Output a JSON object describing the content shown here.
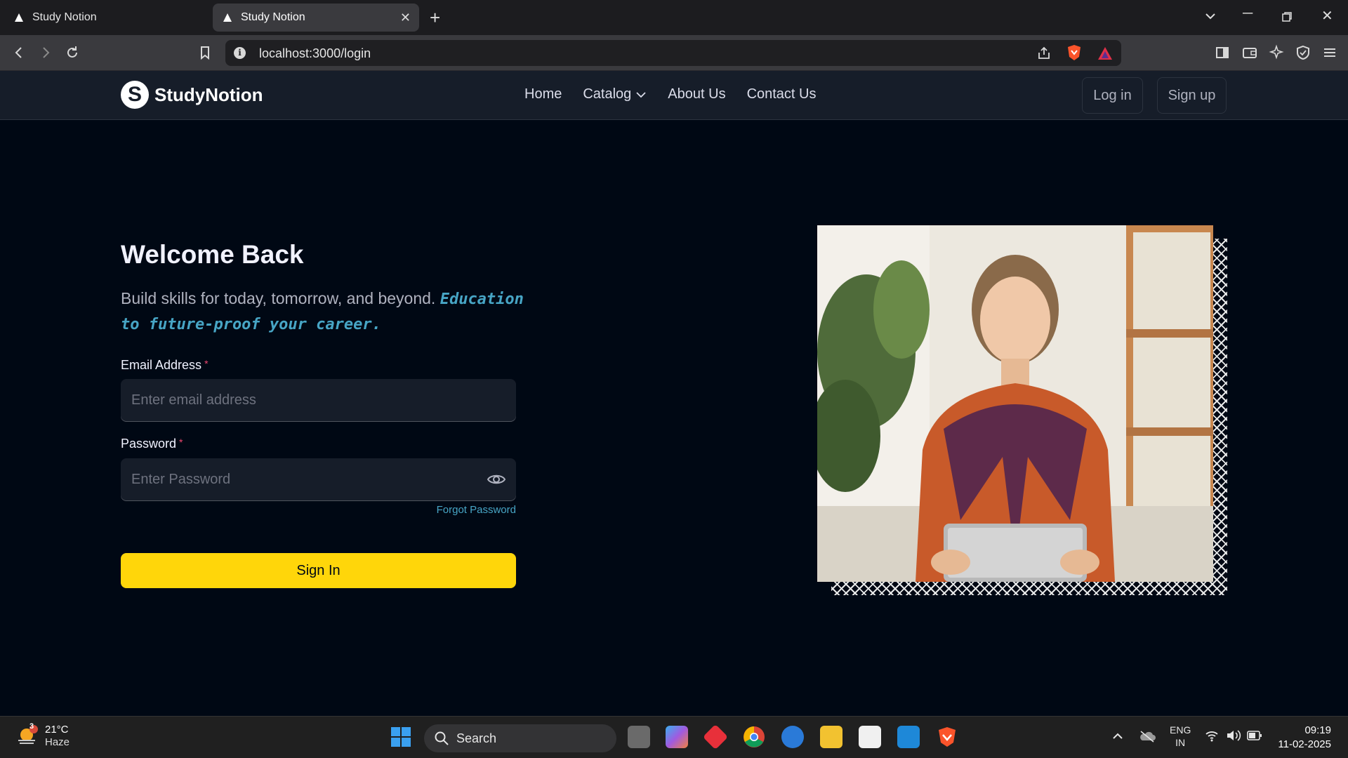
{
  "browser": {
    "tabs": [
      {
        "title": "Study Notion"
      },
      {
        "title": "Study Notion"
      }
    ],
    "url": "localhost:3000/login"
  },
  "nav": {
    "brand": "StudyNotion",
    "brand_badge": "S",
    "links": [
      "Home",
      "Catalog",
      "About Us",
      "Contact Us"
    ],
    "login": "Log in",
    "signup": "Sign up"
  },
  "login": {
    "title": "Welcome Back",
    "subtitle": "Build skills for today, tomorrow, and beyond.",
    "subtitle_accent": "Education to future-proof your career.",
    "email_label": "Email Address",
    "email_placeholder": "Enter email address",
    "password_label": "Password",
    "password_placeholder": "Enter Password",
    "required_mark": "*",
    "forgot": "Forgot Password",
    "submit": "Sign In"
  },
  "taskbar": {
    "weather_badge": "3",
    "temp": "21°C",
    "condition": "Haze",
    "search": "Search",
    "lang_top": "ENG",
    "lang_bottom": "IN",
    "time": "09:19",
    "date": "11-02-2025"
  },
  "colors": {
    "background": "#000814",
    "nav": "#161d29",
    "accent_yellow": "#ffd60a",
    "accent_blue": "#47a5c5",
    "required": "#ef476f"
  }
}
